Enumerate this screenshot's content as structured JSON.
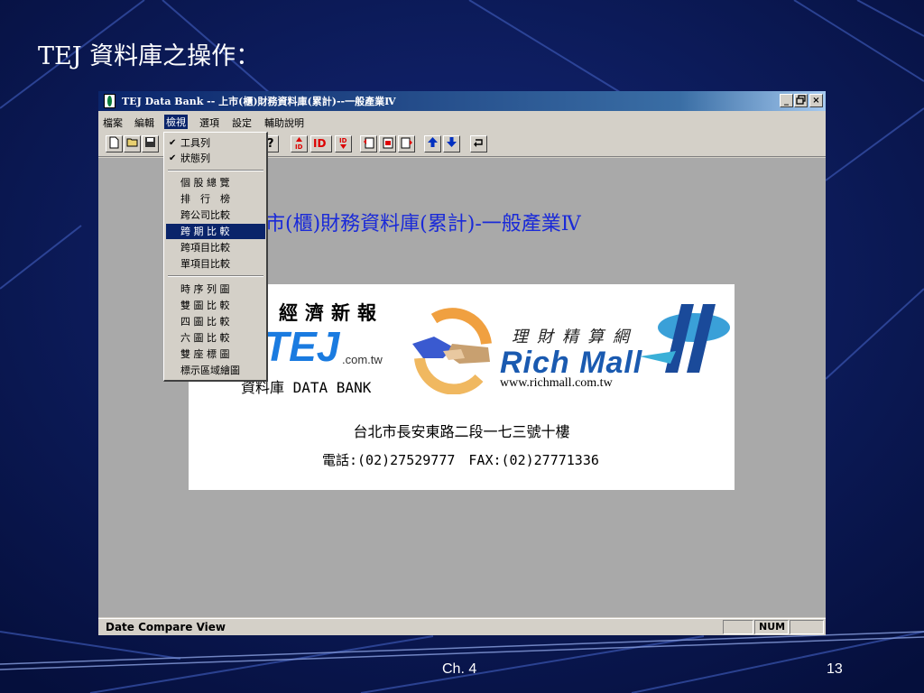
{
  "slide": {
    "title": "TEJ 資料庫之操作：",
    "footer_center": "Ch. 4",
    "page_number": "13"
  },
  "window": {
    "title": "TEJ Data Bank -- 上市(櫃)財務資料庫(累計)--一般產業Ⅳ",
    "controls": {
      "minimize": "_",
      "restore": "🗗",
      "close": "×"
    }
  },
  "menubar": {
    "items": [
      {
        "label": "檔案"
      },
      {
        "label": "編輯"
      },
      {
        "label": "檢視",
        "active": true
      },
      {
        "label": "選項"
      },
      {
        "label": "設定"
      },
      {
        "label": "輔助說明"
      }
    ]
  },
  "toolbar": {
    "icons": [
      "new-file-icon",
      "open-folder-icon",
      "save-icon",
      "help-icon",
      "sort-id-asc-icon",
      "id-icon",
      "sort-id-desc-icon",
      "report-1-icon",
      "report-2-icon",
      "report-3-icon",
      "arrow-up-icon",
      "arrow-down-icon",
      "return-icon"
    ]
  },
  "view_menu": {
    "items": [
      {
        "label": "工具列",
        "checked": true
      },
      {
        "label": "狀態列",
        "checked": true
      },
      {
        "label": "個 股 總 覽"
      },
      {
        "label": "排　行　榜"
      },
      {
        "label": "跨公司比較"
      },
      {
        "label": "跨 期 比 較",
        "selected": true
      },
      {
        "label": "跨項目比較"
      },
      {
        "label": "單項目比較"
      },
      {
        "label": "時 序 列 圖"
      },
      {
        "label": "雙 圖 比 較"
      },
      {
        "label": "四 圖 比 較"
      },
      {
        "label": "六 圖 比 較"
      },
      {
        "label": "雙 座 標 圖"
      },
      {
        "label": "標示區域繪圖"
      }
    ]
  },
  "client": {
    "heading": "市(櫃)財務資料庫(累計)-一般產業Ⅳ",
    "banner": {
      "jingji": "經濟新報",
      "tej": "TEJ",
      "comtw": ".com.tw",
      "databank": "資料庫 DATA BANK",
      "licai": "理財精算網",
      "richmall": "Rich Mall",
      "url": "www.richmall.com.tw",
      "address": "台北市長安東路二段一七三號十樓",
      "phone": "電話:(02)27529777　FAX:(02)27771336"
    }
  },
  "statusbar": {
    "text": "Date Compare View",
    "num": "NUM"
  },
  "colors": {
    "slide_bg": "#0a1a5e",
    "title_bar": "#0a246a",
    "heading_blue": "#1a2ad8",
    "tej_blue": "#1a7be0",
    "selection": "#0a246a"
  }
}
